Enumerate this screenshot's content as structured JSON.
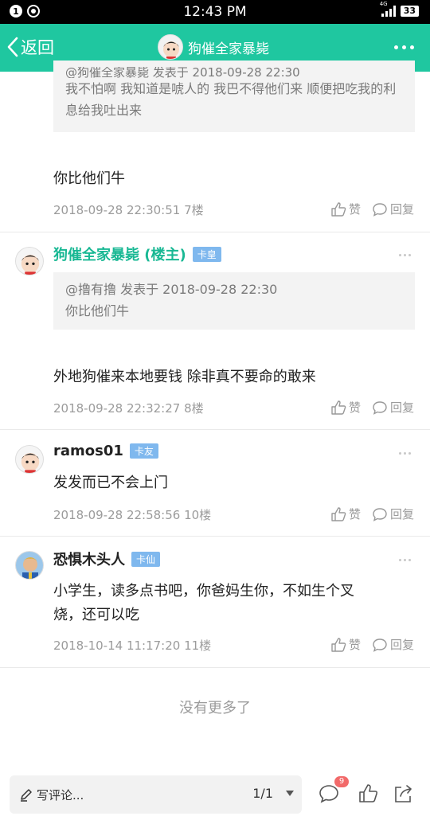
{
  "status_bar": {
    "time": "12:43 PM",
    "notif_count": "1",
    "network": "4G",
    "battery": "33"
  },
  "nav": {
    "back_label": "返回",
    "title": "狗催全家暴毙"
  },
  "partial_post": {
    "quote_header": "@狗催全家暴毙 发表于 2018-09-28 22:30",
    "quote_text": "我不怕啊 我知道是唬人的 我巴不得他们来 顺便把吃我的利息给我吐出来",
    "body": "你比他们牛",
    "meta": "2018-09-28 22:30:51  7楼"
  },
  "actions": {
    "like": "赞",
    "reply": "回复"
  },
  "posts": [
    {
      "username": "狗催全家暴毙 (楼主)",
      "badge": "卡皇",
      "quote_header": "@撸有撸 发表于 2018-09-28 22:30",
      "quote_text": "你比他们牛",
      "body": "外地狗催来本地要钱 除非真不要命的敢来",
      "meta": "2018-09-28 22:32:27  8楼"
    },
    {
      "username": "ramos01",
      "badge": "卡友",
      "body": "发发而已不会上门",
      "meta": "2018-09-28 22:58:56  10楼"
    },
    {
      "username": "恐惧木头人",
      "badge": "卡仙",
      "body_line1": "小学生，读多点书吧，你爸妈生你，不如生个叉",
      "body_line2": "烧，还可以吃",
      "meta": "2018-10-14 11:17:20  11楼"
    }
  ],
  "no_more": "没有更多了",
  "bottom_bar": {
    "placeholder": "写评论...",
    "page": "1/1",
    "comment_badge": "9"
  },
  "colors": {
    "brand": "#1fc7a0",
    "owner_name": "#19b894",
    "badge": "#7fb8ee"
  }
}
